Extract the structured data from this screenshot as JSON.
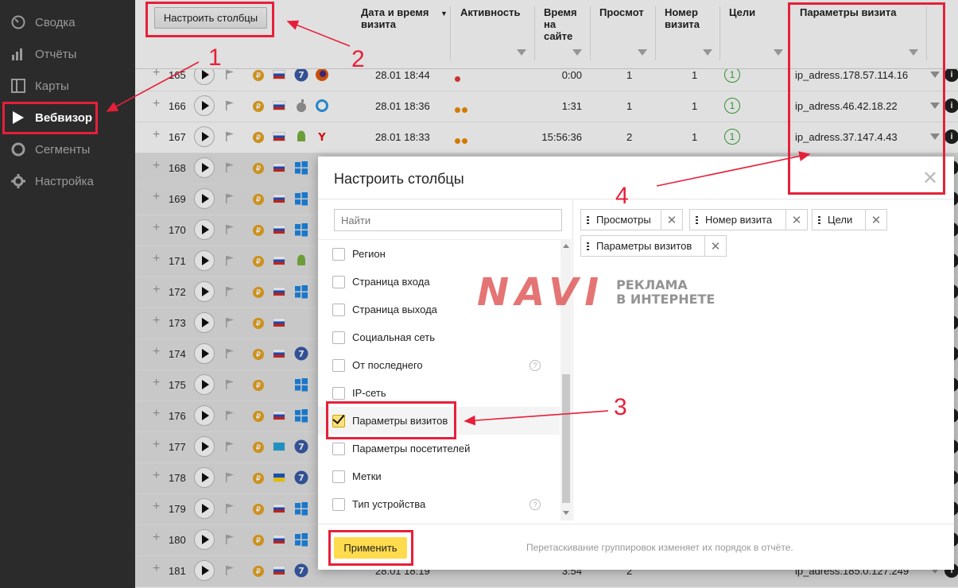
{
  "sidebar": {
    "items": [
      {
        "label": "Сводка",
        "icon": "gauge-icon"
      },
      {
        "label": "Отчёты",
        "icon": "bar-chart-icon"
      },
      {
        "label": "Карты",
        "icon": "map-icon"
      },
      {
        "label": "Вебвизор",
        "icon": "play-icon",
        "active": true
      },
      {
        "label": "Сегменты",
        "icon": "segments-icon"
      },
      {
        "label": "Настройка",
        "icon": "gear-icon"
      }
    ]
  },
  "toolbar": {
    "columns_button": "Настроить столбцы"
  },
  "table": {
    "headers": {
      "datetime": [
        "Дата и время",
        "визита"
      ],
      "activity": [
        "Активность"
      ],
      "time_on_site": [
        "Время",
        "на",
        "сайте"
      ],
      "views": [
        "Просмот"
      ],
      "visit_number": [
        "Номер",
        "визита"
      ],
      "goals": [
        "Цели"
      ],
      "visit_params": [
        "Параметры визита"
      ]
    },
    "rows": [
      {
        "num": "165",
        "date": "28.01 18:44",
        "activity": "1",
        "time": "0:00",
        "views": "1",
        "visit_num": "1",
        "goals": "1",
        "params": "ip_adress.178.57.114.16",
        "os": "windows7",
        "browser": "firefox"
      },
      {
        "num": "166",
        "date": "28.01 18:36",
        "activity": "2",
        "time": "1:31",
        "views": "1",
        "visit_num": "1",
        "goals": "1",
        "params": "ip_adress.46.42.18.22",
        "os": "apple",
        "browser": "safari"
      },
      {
        "num": "167",
        "date": "28.01 18:33",
        "activity": "2",
        "time": "15:56:36",
        "views": "2",
        "visit_num": "1",
        "goals": "1",
        "params": "ip_adress.37.147.4.43",
        "os": "android",
        "browser": "yandex"
      },
      {
        "num": "168",
        "os": "windows"
      },
      {
        "num": "169",
        "os": "windows"
      },
      {
        "num": "170",
        "os": "windows"
      },
      {
        "num": "171",
        "os": "android"
      },
      {
        "num": "172",
        "os": "windows"
      },
      {
        "num": "173",
        "os": ""
      },
      {
        "num": "174",
        "os": "windows7"
      },
      {
        "num": "175",
        "os": "windows"
      },
      {
        "num": "176",
        "os": "windows"
      },
      {
        "num": "177",
        "os": "windows7"
      },
      {
        "num": "178",
        "os": "windows7"
      },
      {
        "num": "179",
        "os": "windows"
      },
      {
        "num": "180",
        "os": "windows"
      },
      {
        "num": "181",
        "date": "28.01 18:19",
        "time": "3:54",
        "views": "2",
        "params": "ip_adress.185.0.127.249",
        "os": "windows7"
      }
    ]
  },
  "modal": {
    "title": "Настроить столбцы",
    "search_placeholder": "Найти",
    "options": [
      {
        "label": "Регион",
        "checked": false
      },
      {
        "label": "Страница входа",
        "checked": false
      },
      {
        "label": "Страница выхода",
        "checked": false
      },
      {
        "label": "Социальная сеть",
        "checked": false
      },
      {
        "label": "От последнего",
        "checked": false,
        "help": true
      },
      {
        "label": "IP-сеть",
        "checked": false
      },
      {
        "label": "Параметры визитов",
        "checked": true
      },
      {
        "label": "Параметры посетителей",
        "checked": false
      },
      {
        "label": "Метки",
        "checked": false
      },
      {
        "label": "Тип устройства",
        "checked": false,
        "help": true
      }
    ],
    "selected_chips": [
      "Просмотры",
      "Номер визита",
      "Цели",
      "Параметры визитов"
    ],
    "apply_button": "Применить",
    "hint": "Перетаскивание группировок изменяет их порядок в отчёте."
  },
  "watermark": {
    "brand": "NAVI",
    "line1": "РЕКЛАМА",
    "line2": "В ИНТЕРНЕТЕ"
  },
  "annotations": [
    "1",
    "2",
    "3",
    "4"
  ],
  "colors": {
    "sidebar_bg": "#2b2b2b",
    "accent_yellow": "#ffdb4d",
    "annotation_red": "#e6203a",
    "goal_green": "#3aa43a"
  }
}
